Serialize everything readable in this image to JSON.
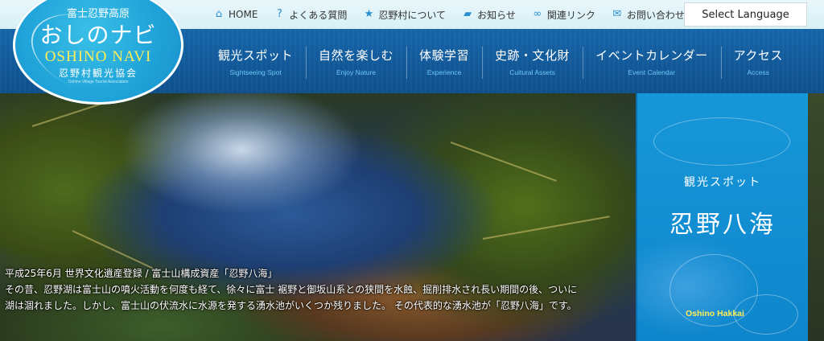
{
  "logo": {
    "line1": "富士忍野高原",
    "line2": "おしのナビ",
    "line3": "OSHINO NAVI",
    "line4": "忍野村観光協会",
    "line5": "Oshino Village Tourist Association"
  },
  "topnav": [
    {
      "label": "HOME",
      "icon": "home-icon"
    },
    {
      "label": "よくある質問",
      "icon": "question-icon"
    },
    {
      "label": "忍野村について",
      "icon": "star-icon"
    },
    {
      "label": "お知らせ",
      "icon": "chat-icon"
    },
    {
      "label": "関連リンク",
      "icon": "link-icon"
    },
    {
      "label": "お問い合わせ",
      "icon": "mail-icon"
    }
  ],
  "language_button": "Select Language",
  "mainnav": [
    {
      "jp": "観光スポット",
      "en": "Sightseeing Spot"
    },
    {
      "jp": "自然を楽しむ",
      "en": "Enjoy Nature"
    },
    {
      "jp": "体験学習",
      "en": "Experience"
    },
    {
      "jp": "史跡・文化財",
      "en": "Cultural Assets"
    },
    {
      "jp": "イベントカレンダー",
      "en": "Event Calendar"
    },
    {
      "jp": "アクセス",
      "en": "Access"
    }
  ],
  "hero": {
    "caption_line1": "平成25年6月 世界文化遺産登録 / 富士山構成資産「忍野八海」",
    "caption_line2": "その昔、忍野湖は富士山の噴火活動を何度も経て、徐々に富士 裾野と御坂山系との狭間を水蝕、掘削排水され長い期間の後、ついに",
    "caption_line3": "湖は涸れました。しかし、富士山の伏流水に水源を発する湧水池がいくつか残りました。 その代表的な湧水池が「忍野八海」です。"
  },
  "panel": {
    "subtitle": "観光スポット",
    "title": "忍野八海",
    "english": "Oshino Hakkai"
  },
  "colors": {
    "navbar": "#1565a9",
    "accent": "#20a4d9",
    "highlight": "#ffee57"
  }
}
